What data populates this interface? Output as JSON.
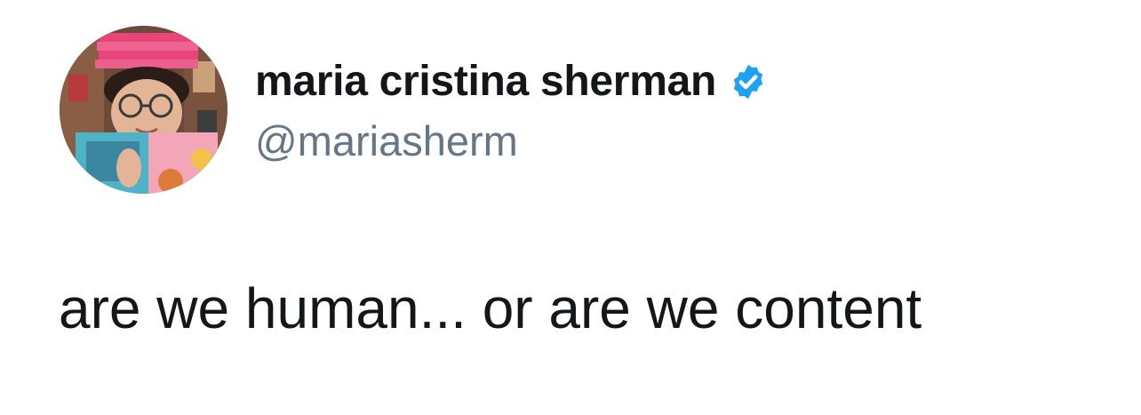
{
  "author": {
    "display_name": "maria cristina sherman",
    "handle": "@mariasherm",
    "verified": true,
    "avatar_icon": "avatar-photo",
    "verified_icon": "verified-badge-icon",
    "verified_color": "#1da1f2"
  },
  "tweet": {
    "text": "are we human... or are we content"
  },
  "colors": {
    "name": "#14171a",
    "handle": "#657786",
    "background": "#ffffff"
  }
}
